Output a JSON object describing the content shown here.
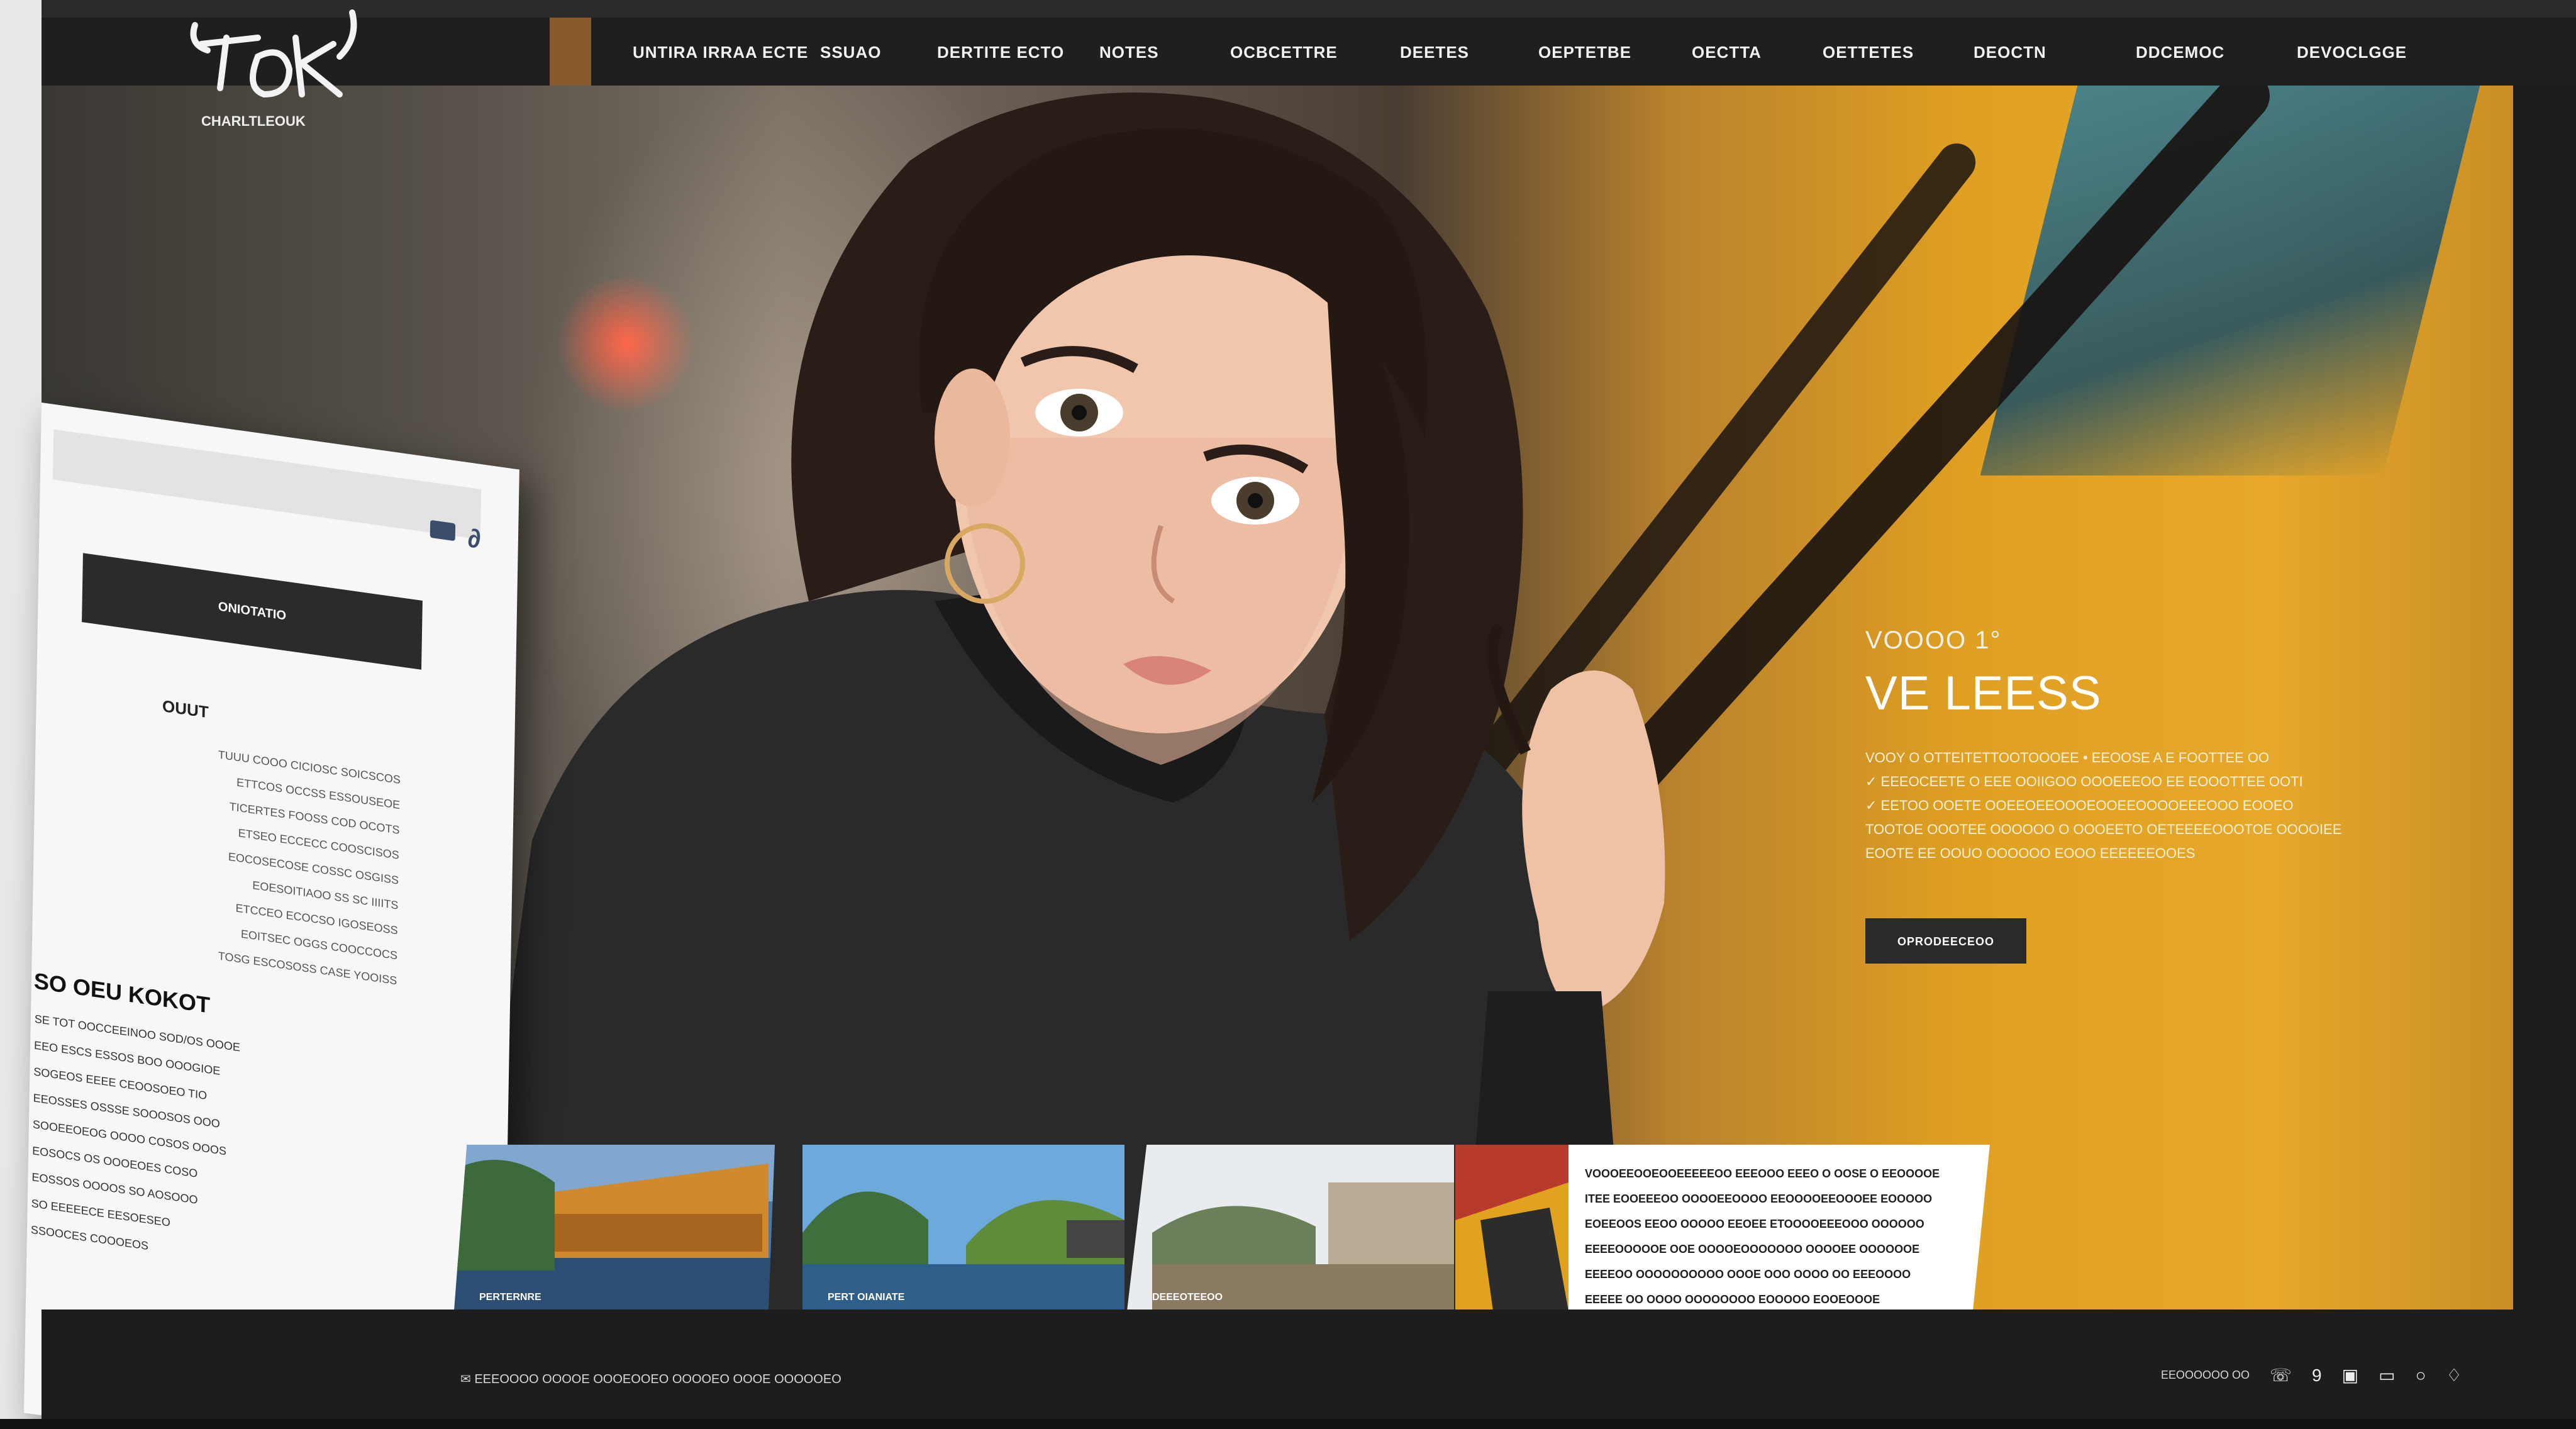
{
  "brand": {
    "logo_text": "TOEK",
    "logo_subtitle": "CHARLTLEOUK",
    "accent_color": "#8a5a2c"
  },
  "nav": {
    "items": [
      "UNTIRA IRRAA ECTE",
      "SSUAO",
      "DERTITE ECTO",
      "NOTES",
      "OCBCETTRE",
      "DEETES",
      "OEPTETBE",
      "OECTTA",
      "OETTETES",
      "DEOCTN",
      "DDCEMOC",
      "DEVOCLGGE"
    ]
  },
  "paper": {
    "dark_bar_label": "ONIOTATIO",
    "heading": "OUUT",
    "lines": [
      "TUUU COOO CICIOSC SOICSCOS",
      "ETTCOS OCCSS ESSOUSEOE",
      "TICERTES FOOSS COD OCOTS",
      "ETSEO ECCECC COOSCISOS",
      "EOCOSECOSE COSSC OSGISS",
      "EOESOITIAOO SS SC IIIITS",
      "ETCCEO ECOCSO IGOSEOSS",
      "EOITSEC OGGS COOCCOCS",
      "TOSG ESCOSOSS CASE YOOISS"
    ],
    "subheading": "SO OEU KOKOT",
    "lines2": [
      "SE TOT OOCCEEINOO SOD/OS OOOE",
      "EEO ESCS ESSOS BOO OOOGIOE",
      "SOGEOS EEEE CEOOSOEO TIO",
      "EEOSSES OSSSE SOOOSOS OOO",
      "SOOEEOEOG OOOO COSOS OOOS",
      "EOSOCS OS OOOEOES COSO",
      "EOSSOS OOOOS SO AOSOOO",
      "SO EEEEECE EESOESEO",
      "SSOOCES COOOEOS"
    ]
  },
  "hero": {
    "kicker": "VOOOO 1°",
    "headline": "VE LEESS",
    "body": [
      "VOOY O OTTEITETTOOTOOOEE • EEOOSE A E FOOTTEE OO",
      "✓ EEEOCEETE O EEE OOIIGOO OOOEEEOO EE EOOOTTEE OOTI",
      "✓ EETOO OOETE OOEEOEEOOOEOOEEOOOOEEEOOO EOOEO",
      "TOOTOE OOOTEE OOOOOO O OOOEETO OETEEEEOOOTOE OOOOIEE",
      "EOOTE EE OOUO OOOOOO EOOO EEEEEEOOES"
    ],
    "cta_label": "OPRODEECEOO"
  },
  "thumbnails": [
    {
      "label": "PERTERNRE"
    },
    {
      "label": "PERT OIANIATE"
    },
    {
      "label": "DEEEOTEEOO"
    },
    {
      "label": ""
    }
  ],
  "text_card": {
    "lines": [
      "VOOOEEOOEOOEEEEEOO EEEOOO EEEO O OOSE O EEOOOOE",
      "ITEE EOOEEEOO OOOOEEOOOO EEOOOOEEOOOEE EOOOOO",
      "EOEEOOS EEOO OOOOO EEOEE ETOOOOEEEOOO OOOOOO",
      "EEEEOOOOOE OOE OOOOEOOOOOOO OOOOEE OOOOOOE",
      "EEEEOO OOOOOOOOOO OOOE OOO OOOO OO EEEOOOO",
      "EEEEE OO OOOO OOOOOOOO EOOOOO EOOEOOOE"
    ]
  },
  "footer": {
    "left_text": "EEEOOOO OOOOE OOOEOOEO OOOOEO OOOE OOOOOEO",
    "right_label": "EEOOOOOO OO",
    "icons": [
      "phone-icon",
      "nine-icon",
      "t-icon",
      "chat-icon",
      "globe-icon",
      "pin-icon"
    ]
  }
}
